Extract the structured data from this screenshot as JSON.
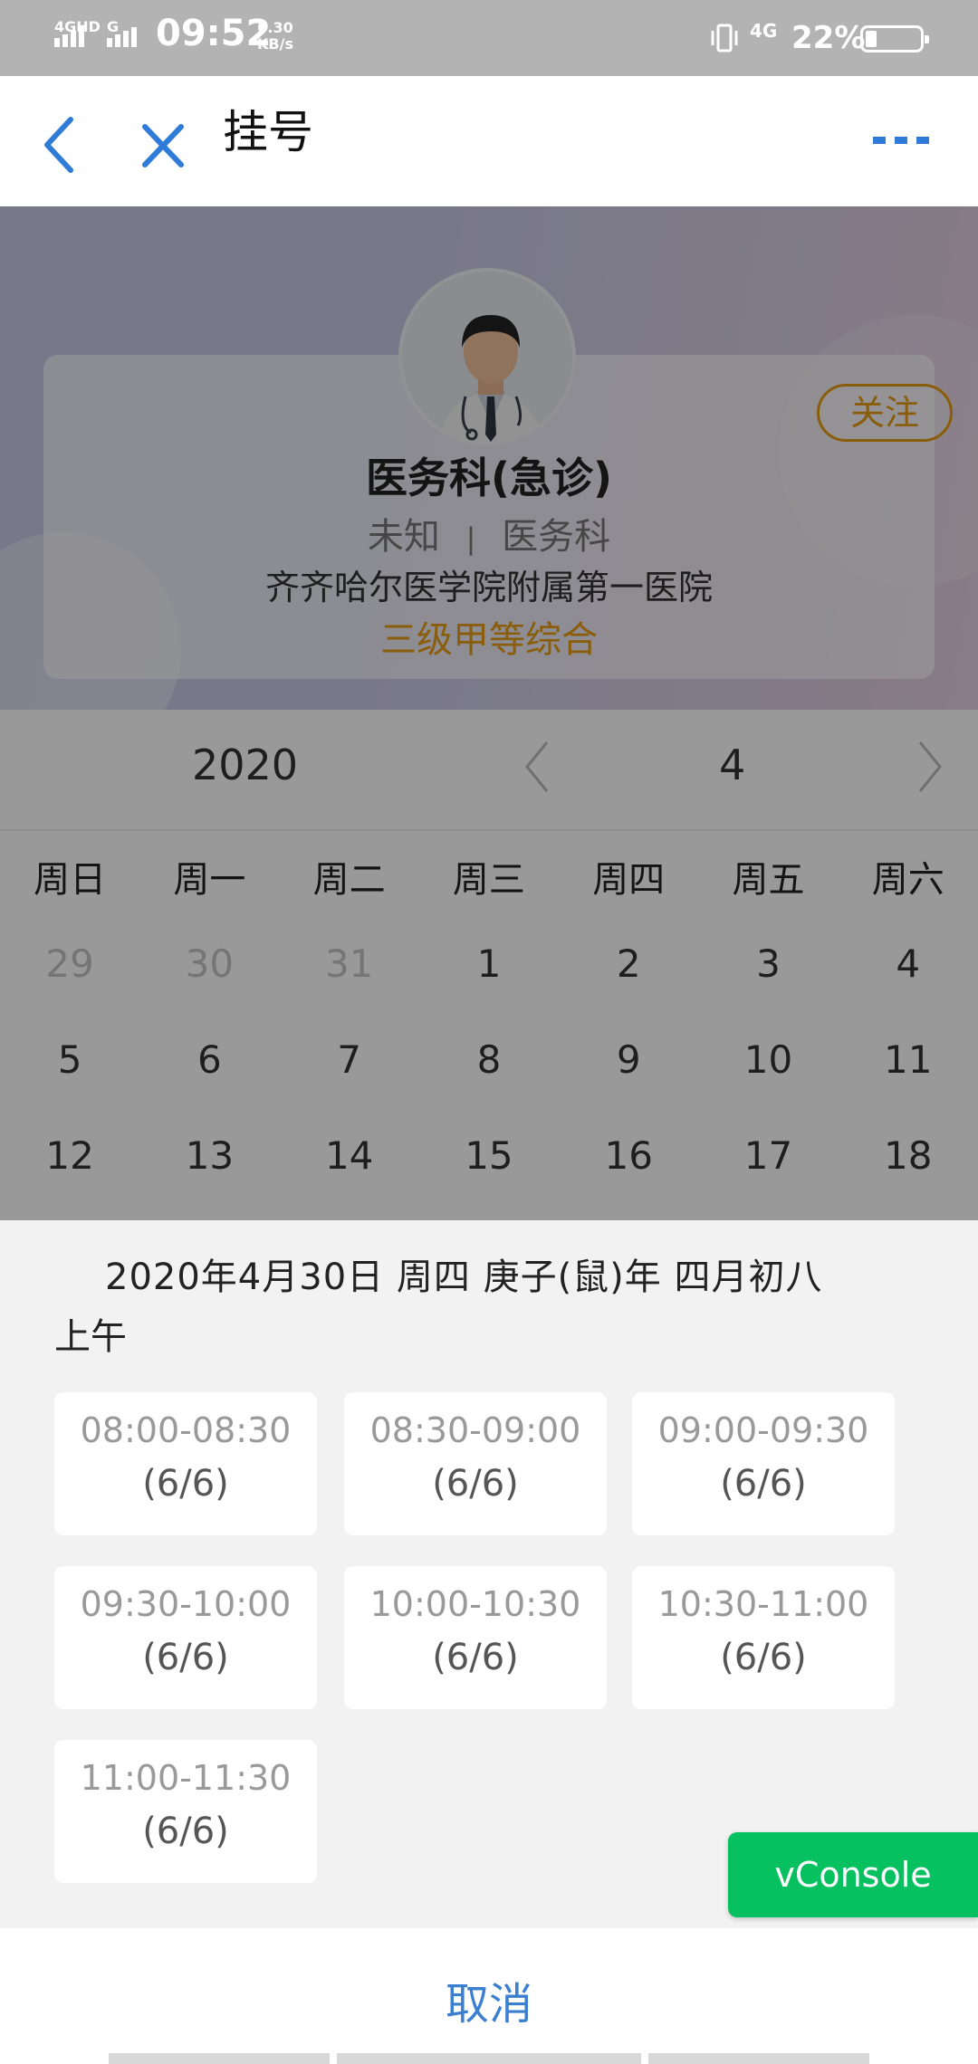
{
  "status_bar": {
    "network1": "4GHD",
    "network2": "G",
    "time": "09:52",
    "speed_value": "0.30",
    "speed_unit": "KB/s",
    "network3": "4G",
    "battery": "22%",
    "battery_level": 0.22
  },
  "nav": {
    "title": "挂号",
    "icons": [
      "back-icon",
      "close-icon",
      "more-icon"
    ],
    "accent_color": "#2f7bd8"
  },
  "profile": {
    "department": "医务科(急诊)",
    "title_label": "未知",
    "separator": "|",
    "dept_label": "医务科",
    "hospital": "齐齐哈尔医学院附属第一医院",
    "level": "三级甲等综合",
    "follow_label": "关注",
    "highlight_color": "#e69b12"
  },
  "calendar": {
    "year": "2020",
    "month": "4",
    "weekdays": [
      "周日",
      "周一",
      "周二",
      "周三",
      "周四",
      "周五",
      "周六"
    ],
    "weeks": [
      [
        "29",
        "30",
        "31",
        "1",
        "2",
        "3",
        "4"
      ],
      [
        "5",
        "6",
        "7",
        "8",
        "9",
        "10",
        "11"
      ],
      [
        "12",
        "13",
        "14",
        "15",
        "16",
        "17",
        "18"
      ]
    ]
  },
  "sheet": {
    "date_line": "2020年4月30日 周四 庚子(鼠)年 四月初八",
    "period": "上午",
    "slots": [
      {
        "time": "08:00-08:30",
        "count": "(6/6)"
      },
      {
        "time": "08:30-09:00",
        "count": "(6/6)"
      },
      {
        "time": "09:00-09:30",
        "count": "(6/6)"
      },
      {
        "time": "09:30-10:00",
        "count": "(6/6)"
      },
      {
        "time": "10:00-10:30",
        "count": "(6/6)"
      },
      {
        "time": "10:30-11:00",
        "count": "(6/6)"
      },
      {
        "time": "11:00-11:30",
        "count": "(6/6)"
      }
    ],
    "cancel_label": "取消"
  },
  "vconsole_label": "vConsole"
}
